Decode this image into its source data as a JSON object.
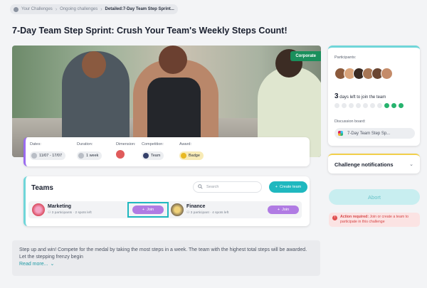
{
  "breadcrumb": {
    "items": [
      "Your Challenges",
      "Ongoing challenges",
      "Detailed:7-Day Team Step Sprint..."
    ]
  },
  "page": {
    "title": "7-Day Team Step Sprint: Crush Your Team's Weekly Steps Count!"
  },
  "hero": {
    "tag": "Corporate"
  },
  "info": {
    "dates_label": "Dates:",
    "dates_value": "11/07 - 17/07",
    "duration_label": "Duration:",
    "duration_value": "1 week",
    "dimension_label": "Dimension:",
    "competition_label": "Competition:",
    "competition_value": "Team",
    "award_label": "Award:",
    "award_value": "Badge"
  },
  "teams": {
    "title": "Teams",
    "search_placeholder": "Search",
    "create_label": "Create team",
    "list": [
      {
        "name": "Marketing",
        "participants": "3 participants",
        "spots": "2 spots left",
        "join_label": "Join"
      },
      {
        "name": "Finance",
        "participants": "3 participant",
        "spots": "4 spots left",
        "join_label": "Join"
      }
    ]
  },
  "description": {
    "text": "Step up and win! Compete for the medal by taking the most steps in a week. The team with the highest total steps will be awarded. Let the stepping frenzy begin",
    "read_more": "Read more..."
  },
  "sidebar": {
    "participants_label": "Participants:",
    "days_number": "3",
    "days_text": "days left to join the team",
    "days_total": 10,
    "days_remaining": 3,
    "board_label": "Discussion board:",
    "board_value": "7-Day Team Step Sp...",
    "notifications_label": "Challenge notifications",
    "abort_label": "Abort",
    "alert_title": "Action required:",
    "alert_text": "Join or create a team to participate in this challenge"
  },
  "colors": {
    "accent": "#1fb8bf",
    "join": "#b07be3",
    "corporate": "#1a8f5c",
    "alert": "#d64545"
  }
}
